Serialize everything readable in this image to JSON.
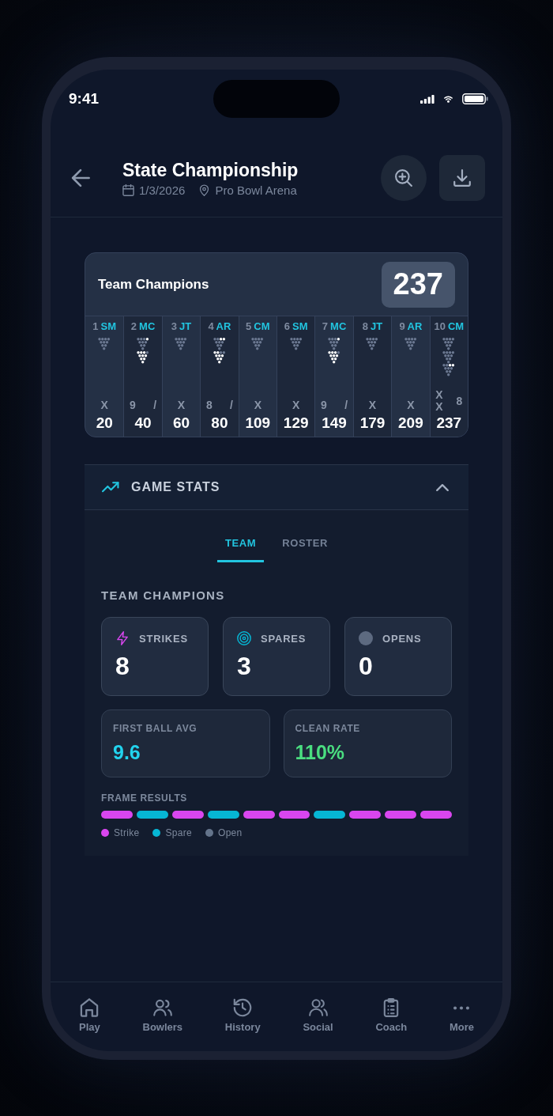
{
  "status_bar": {
    "time": "9:41"
  },
  "header": {
    "title": "State Championship",
    "date": "1/3/2026",
    "venue": "Pro Bowl Arena"
  },
  "scorecard": {
    "team": "Team Champions",
    "total": "237",
    "frames": [
      {
        "number": "1",
        "bowler": "SM",
        "racks": [
          {
            "lit": [
              false,
              false,
              false,
              false,
              false,
              false,
              false,
              false,
              false,
              false
            ]
          }
        ],
        "rolls": [
          "X"
        ],
        "score": "20"
      },
      {
        "number": "2",
        "bowler": "MC",
        "racks": [
          {
            "lit": [
              false,
              false,
              false,
              false,
              false,
              false,
              false,
              false,
              false,
              true
            ]
          },
          {
            "lit": [
              true,
              true,
              true,
              true,
              true,
              true,
              true,
              true,
              true,
              false
            ]
          }
        ],
        "rolls": [
          "9",
          "/"
        ],
        "score": "40"
      },
      {
        "number": "3",
        "bowler": "JT",
        "racks": [
          {
            "lit": [
              false,
              false,
              false,
              false,
              false,
              false,
              false,
              false,
              false,
              false
            ]
          }
        ],
        "rolls": [
          "X"
        ],
        "score": "60"
      },
      {
        "number": "4",
        "bowler": "AR",
        "racks": [
          {
            "lit": [
              false,
              false,
              false,
              false,
              false,
              false,
              false,
              false,
              true,
              true
            ]
          },
          {
            "lit": [
              true,
              true,
              true,
              true,
              true,
              true,
              true,
              true,
              false,
              false
            ]
          }
        ],
        "rolls": [
          "8",
          "/"
        ],
        "score": "80"
      },
      {
        "number": "5",
        "bowler": "CM",
        "racks": [
          {
            "lit": [
              false,
              false,
              false,
              false,
              false,
              false,
              false,
              false,
              false,
              false
            ]
          }
        ],
        "rolls": [
          "X"
        ],
        "score": "109"
      },
      {
        "number": "6",
        "bowler": "SM",
        "racks": [
          {
            "lit": [
              false,
              false,
              false,
              false,
              false,
              false,
              false,
              false,
              false,
              false
            ]
          }
        ],
        "rolls": [
          "X"
        ],
        "score": "129"
      },
      {
        "number": "7",
        "bowler": "MC",
        "racks": [
          {
            "lit": [
              false,
              false,
              false,
              false,
              false,
              false,
              false,
              false,
              false,
              true
            ]
          },
          {
            "lit": [
              true,
              true,
              true,
              true,
              true,
              true,
              true,
              true,
              true,
              false
            ]
          }
        ],
        "rolls": [
          "9",
          "/"
        ],
        "score": "149"
      },
      {
        "number": "8",
        "bowler": "JT",
        "racks": [
          {
            "lit": [
              false,
              false,
              false,
              false,
              false,
              false,
              false,
              false,
              false,
              false
            ]
          }
        ],
        "rolls": [
          "X"
        ],
        "score": "179"
      },
      {
        "number": "9",
        "bowler": "AR",
        "racks": [
          {
            "lit": [
              false,
              false,
              false,
              false,
              false,
              false,
              false,
              false,
              false,
              false
            ]
          }
        ],
        "rolls": [
          "X"
        ],
        "score": "209"
      },
      {
        "number": "10",
        "bowler": "CM",
        "racks": [
          {
            "lit": [
              false,
              false,
              false,
              false,
              false,
              false,
              false,
              false,
              false,
              false
            ]
          },
          {
            "lit": [
              false,
              false,
              false,
              false,
              false,
              false,
              false,
              false,
              false,
              false
            ]
          },
          {
            "lit": [
              false,
              false,
              false,
              false,
              false,
              false,
              false,
              false,
              true,
              true
            ]
          }
        ],
        "rolls": [
          "X",
          "X",
          "8"
        ],
        "score": "237"
      }
    ]
  },
  "game_stats": {
    "title": "GAME STATS",
    "expanded": true,
    "tabs": [
      {
        "label": "TEAM",
        "selected": true
      },
      {
        "label": "ROSTER",
        "selected": false
      }
    ],
    "team_name": "TEAM CHAMPIONS",
    "counts": [
      {
        "label": "STRIKES",
        "value": "8"
      },
      {
        "label": "SPARES",
        "value": "3"
      },
      {
        "label": "OPENS",
        "value": "0"
      }
    ],
    "metrics": [
      {
        "label": "FIRST BALL AVG",
        "value": "9.6",
        "color": "#22d3ee"
      },
      {
        "label": "CLEAN RATE",
        "value": "110%",
        "color": "#4ade80"
      }
    ],
    "frame_results": {
      "title": "FRAME RESULTS",
      "bars": [
        {
          "color": "#d946ef"
        },
        {
          "color": "#06b6d4"
        },
        {
          "color": "#d946ef"
        },
        {
          "color": "#06b6d4"
        },
        {
          "color": "#d946ef"
        },
        {
          "color": "#d946ef"
        },
        {
          "color": "#06b6d4"
        },
        {
          "color": "#d946ef"
        },
        {
          "color": "#d946ef"
        },
        {
          "color": "#d946ef"
        }
      ],
      "legend": [
        {
          "label": "Strike",
          "color": "#d946ef"
        },
        {
          "label": "Spare",
          "color": "#06b6d4"
        },
        {
          "label": "Open",
          "color": "#64748b"
        }
      ]
    }
  },
  "nav": [
    {
      "label": "Play",
      "selected": false
    },
    {
      "label": "Bowlers",
      "selected": false
    },
    {
      "label": "History",
      "selected": false
    },
    {
      "label": "Social",
      "selected": false
    },
    {
      "label": "Coach",
      "selected": false
    },
    {
      "label": "More",
      "selected": false
    }
  ]
}
